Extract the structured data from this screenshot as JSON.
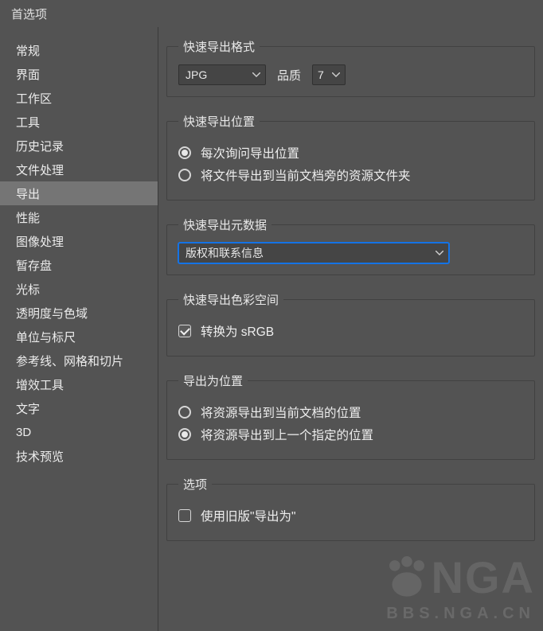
{
  "window": {
    "title": "首选项"
  },
  "sidebar": {
    "items": [
      {
        "label": "常规"
      },
      {
        "label": "界面"
      },
      {
        "label": "工作区"
      },
      {
        "label": "工具"
      },
      {
        "label": "历史记录"
      },
      {
        "label": "文件处理"
      },
      {
        "label": "导出",
        "selected": true
      },
      {
        "label": "性能"
      },
      {
        "label": "图像处理"
      },
      {
        "label": "暂存盘"
      },
      {
        "label": "光标"
      },
      {
        "label": "透明度与色域"
      },
      {
        "label": "单位与标尺"
      },
      {
        "label": "参考线、网格和切片"
      },
      {
        "label": "增效工具"
      },
      {
        "label": "文字"
      },
      {
        "label": "3D"
      },
      {
        "label": "技术预览"
      }
    ]
  },
  "groups": {
    "format": {
      "legend": "快速导出格式",
      "file_format": "JPG",
      "quality_label": "品质",
      "quality_value": "7"
    },
    "location": {
      "legend": "快速导出位置",
      "options": [
        {
          "label": "每次询问导出位置",
          "checked": true
        },
        {
          "label": "将文件导出到当前文档旁的资源文件夹",
          "checked": false
        }
      ]
    },
    "metadata": {
      "legend": "快速导出元数据",
      "value": "版权和联系信息"
    },
    "colorspace": {
      "legend": "快速导出色彩空间",
      "convert_label": "转换为 sRGB",
      "convert_checked": true
    },
    "export_as_location": {
      "legend": "导出为位置",
      "options": [
        {
          "label": "将资源导出到当前文档的位置",
          "checked": false
        },
        {
          "label": "将资源导出到上一个指定的位置",
          "checked": true
        }
      ]
    },
    "options": {
      "legend": "选项",
      "legacy_label": "使用旧版\"导出为\"",
      "legacy_checked": false
    }
  },
  "watermark": {
    "text": "NGA",
    "url": "BBS.NGA.CN"
  }
}
